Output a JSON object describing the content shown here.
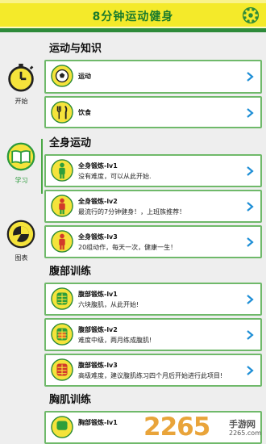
{
  "header": {
    "title": "8分钟运动健身",
    "settings_icon": "gear-icon"
  },
  "sidebar": {
    "items": [
      {
        "label": "开始",
        "icon": "stopwatch-icon",
        "active": false
      },
      {
        "label": "学习",
        "icon": "book-icon",
        "active": true
      },
      {
        "label": "图表",
        "icon": "pie-chart-icon",
        "active": false
      }
    ]
  },
  "sections": [
    {
      "title": "运动与知识",
      "items": [
        {
          "name": "运动",
          "desc": "",
          "icon": "ball-icon"
        },
        {
          "name": "饮食",
          "desc": "",
          "icon": "fork-knife-icon"
        }
      ]
    },
    {
      "title": "全身运动",
      "items": [
        {
          "name": "全身锻炼-lv1",
          "desc": "没有难度，可以从此开始.",
          "icon": "body-green-icon"
        },
        {
          "name": "全身锻炼-lv2",
          "desc": "最流行的7分钟健身！，上班族推荐！",
          "icon": "body-red-icon"
        },
        {
          "name": "全身锻炼-lv3",
          "desc": "20组动作，每天一次，健康一生！",
          "icon": "body-red-icon"
        }
      ]
    },
    {
      "title": "腹部训练",
      "items": [
        {
          "name": "腹部锻炼-lv1",
          "desc": "六块腹肌，从此开始!",
          "icon": "abs-green-icon"
        },
        {
          "name": "腹部锻炼-lv2",
          "desc": "难度中级，两月练成腹肌!",
          "icon": "abs-orange-icon"
        },
        {
          "name": "腹部锻炼-lv3",
          "desc": "高级难度，建议腹肌练习四个月后开始进行此项目!",
          "icon": "abs-red-icon"
        }
      ]
    },
    {
      "title": "胸肌训练",
      "items": [
        {
          "name": "胸部锻炼-lv1",
          "desc": "",
          "icon": "chest-green-icon"
        }
      ]
    }
  ],
  "watermark": {
    "brand": "2265",
    "site": "手游网",
    "url": "2265.com"
  },
  "colors": {
    "header_bg": "#f4ea2a",
    "accent_green": "#4aa845",
    "card_border": "#6fb96a",
    "icon_yellow": "#f5e33b",
    "chevron": "#1f8fd6"
  }
}
